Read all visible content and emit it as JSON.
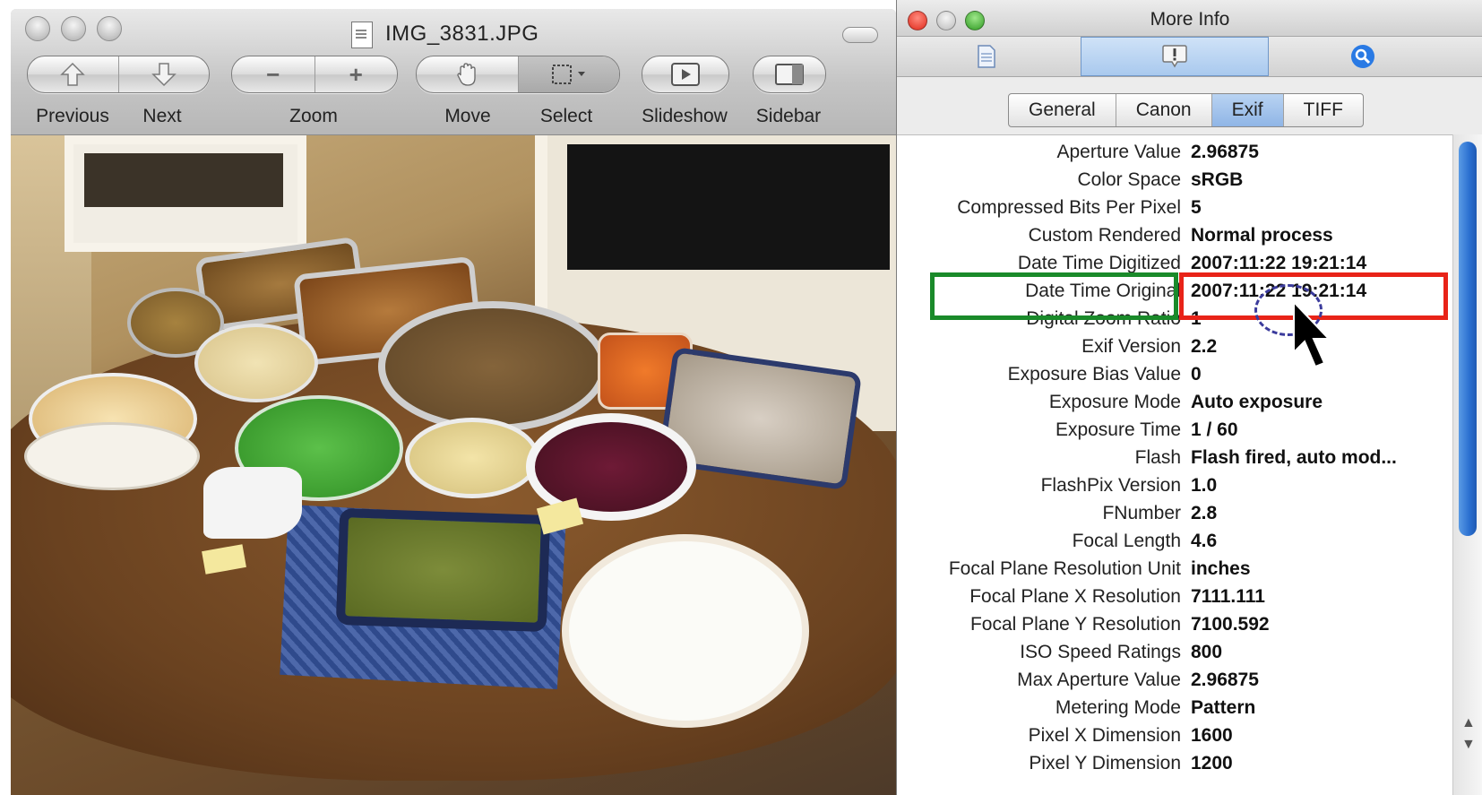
{
  "preview": {
    "title": "IMG_3831.JPG",
    "toolbar": {
      "previous": "Previous",
      "next": "Next",
      "zoom": "Zoom",
      "move": "Move",
      "select": "Select",
      "slideshow": "Slideshow",
      "sidebar": "Sidebar"
    }
  },
  "info": {
    "title": "More Info",
    "subtabs": [
      "General",
      "Canon",
      "Exif",
      "TIFF"
    ],
    "selected_subtab": "Exif",
    "rows": [
      {
        "k": "Aperture Value",
        "v": "2.96875"
      },
      {
        "k": "Color Space",
        "v": "sRGB"
      },
      {
        "k": "Compressed Bits Per Pixel",
        "v": "5"
      },
      {
        "k": "Custom Rendered",
        "v": "Normal process"
      },
      {
        "k": "Date Time Digitized",
        "v": "2007:11:22 19:21:14"
      },
      {
        "k": "Date Time Original",
        "v": "2007:11:22 19:21:14"
      },
      {
        "k": "Digital Zoom Ratio",
        "v": "1"
      },
      {
        "k": "Exif Version",
        "v": "2.2"
      },
      {
        "k": "Exposure Bias Value",
        "v": "0"
      },
      {
        "k": "Exposure Mode",
        "v": "Auto exposure"
      },
      {
        "k": "Exposure Time",
        "v": "1 / 60"
      },
      {
        "k": "Flash",
        "v": "Flash fired, auto mod..."
      },
      {
        "k": "FlashPix Version",
        "v": "1.0"
      },
      {
        "k": "FNumber",
        "v": "2.8"
      },
      {
        "k": "Focal Length",
        "v": "4.6"
      },
      {
        "k": "Focal Plane Resolution Unit",
        "v": "inches"
      },
      {
        "k": "Focal Plane X Resolution",
        "v": "7111.111"
      },
      {
        "k": "Focal Plane Y Resolution",
        "v": "7100.592"
      },
      {
        "k": "ISO Speed Ratings",
        "v": "800"
      },
      {
        "k": "Max Aperture Value",
        "v": "2.96875"
      },
      {
        "k": "Metering Mode",
        "v": "Pattern"
      },
      {
        "k": "Pixel X Dimension",
        "v": "1600"
      },
      {
        "k": "Pixel Y Dimension",
        "v": "1200"
      }
    ]
  },
  "colors": {
    "highlight_key": "#1a8a2a",
    "highlight_value": "#e82318",
    "selection_blue": "#2a6fd0"
  }
}
